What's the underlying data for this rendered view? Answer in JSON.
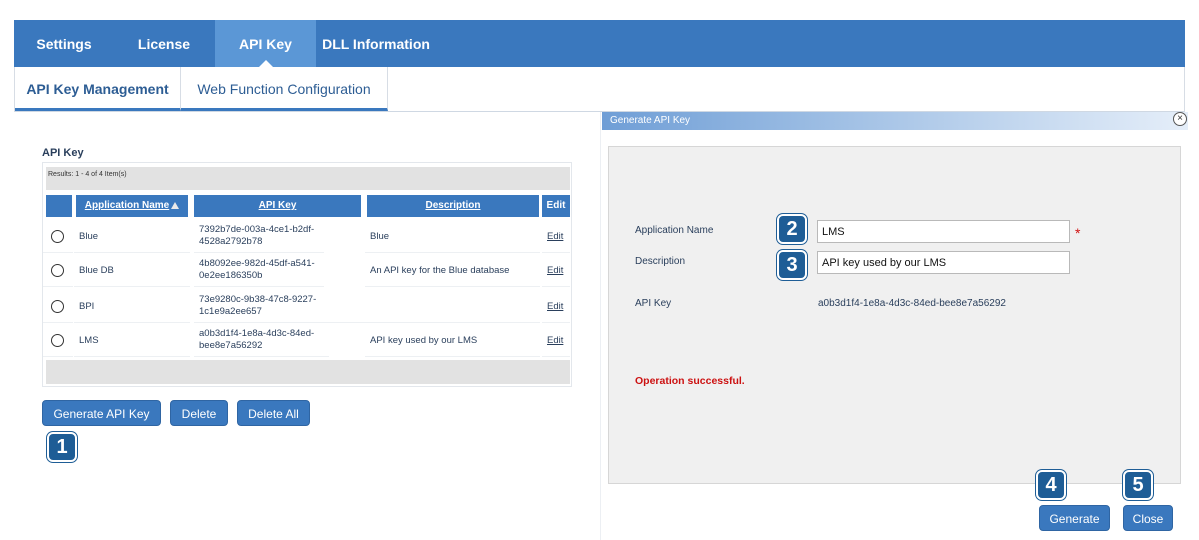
{
  "topnav": {
    "tabs": [
      {
        "label": "Settings"
      },
      {
        "label": "License"
      },
      {
        "label": "API Key"
      },
      {
        "label": "DLL Information"
      }
    ]
  },
  "subnav": {
    "tabs": [
      {
        "label": "API Key Management"
      },
      {
        "label": "Web Function Configuration"
      }
    ]
  },
  "apikey_panel": {
    "title": "API Key",
    "results_text": "Results: 1 - 4 of 4 Item(s)",
    "columns": [
      "Application Name",
      "API Key",
      "Description",
      "Edit"
    ],
    "rows": [
      {
        "app": "Blue",
        "key": "7392b7de-003a-4ce1-b2df-4528a2792b78",
        "desc": "Blue",
        "edit": "Edit"
      },
      {
        "app": "Blue DB",
        "key": "4b8092ee-982d-45df-a541-0e2ee186350b",
        "desc": "An API key for the Blue database",
        "edit": "Edit"
      },
      {
        "app": "BPI",
        "key": "73e9280c-9b38-47c8-9227-1c1e9a2ee657",
        "desc": "",
        "edit": "Edit"
      },
      {
        "app": "LMS",
        "key": "a0b3d1f4-1e8a-4d3c-84ed-bee8e7a56292",
        "desc": "API key used by our LMS",
        "edit": "Edit"
      }
    ],
    "buttons": {
      "generate": "Generate API Key",
      "delete": "Delete",
      "delete_all": "Delete All"
    }
  },
  "dialog": {
    "title": "Generate API Key",
    "close_glyph": "×",
    "app_name_label": "Application Name",
    "app_name_value": "LMS",
    "required_mark": "*",
    "description_label": "Description",
    "description_value": "API key used by our LMS",
    "api_key_label": "API Key",
    "api_key_value": "a0b3d1f4-1e8a-4d3c-84ed-bee8e7a56292",
    "status_message": "Operation successful.",
    "generate_label": "Generate",
    "close_label": "Close"
  },
  "callouts": [
    "1",
    "2",
    "3",
    "4",
    "5"
  ],
  "colors": {
    "nav": "#3a78be",
    "nav_active": "#5b97d6",
    "badge": "#1e5d96",
    "error_red": "#cc1111"
  }
}
